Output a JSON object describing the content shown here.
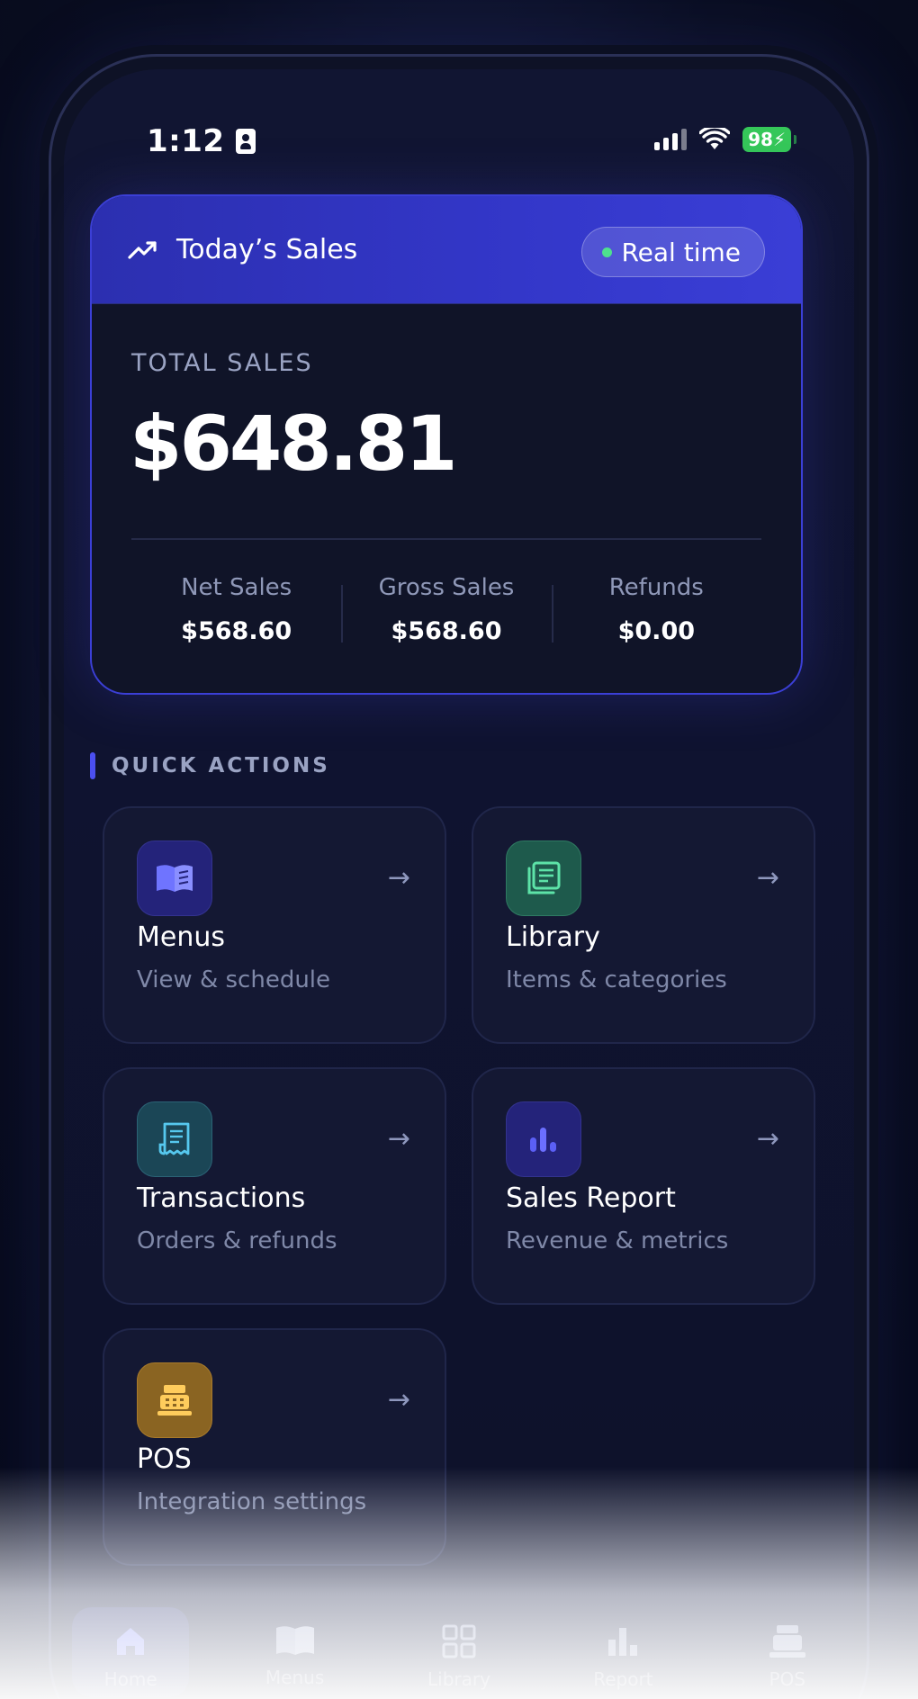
{
  "status_bar": {
    "time": "1:12",
    "battery": "98"
  },
  "sales_card": {
    "title": "Today’s Sales",
    "badge": "Real time",
    "total_label": "TOTAL SALES",
    "total_value": "$648.81",
    "metrics": [
      {
        "label": "Net Sales",
        "value": "$568.60"
      },
      {
        "label": "Gross Sales",
        "value": "$568.60"
      },
      {
        "label": "Refunds",
        "value": "$0.00"
      }
    ]
  },
  "quick_actions": {
    "heading": "QUICK ACTIONS",
    "items": [
      {
        "title": "Menus",
        "subtitle": "View & schedule",
        "icon": "book-icon",
        "arrow": "→"
      },
      {
        "title": "Library",
        "subtitle": "Items & categories",
        "icon": "library-icon",
        "arrow": "→"
      },
      {
        "title": "Transactions",
        "subtitle": "Orders & refunds",
        "icon": "receipt-icon",
        "arrow": "→"
      },
      {
        "title": "Sales Report",
        "subtitle": "Revenue & metrics",
        "icon": "bar-chart-icon",
        "arrow": "→"
      },
      {
        "title": "POS",
        "subtitle": "Integration settings",
        "icon": "cash-register-icon",
        "arrow": "→"
      }
    ]
  },
  "bottom_nav": [
    {
      "label": "Home",
      "icon": "home-icon",
      "active": true
    },
    {
      "label": "Menus",
      "icon": "book-icon"
    },
    {
      "label": "Library",
      "icon": "grid-icon"
    },
    {
      "label": "Report",
      "icon": "bar-chart-icon"
    },
    {
      "label": "POS",
      "icon": "cash-register-icon"
    }
  ],
  "colors": {
    "accent": "#3a3ed6",
    "background": "#0e1229",
    "live_dot": "#4ee08e",
    "battery": "#35c759"
  }
}
